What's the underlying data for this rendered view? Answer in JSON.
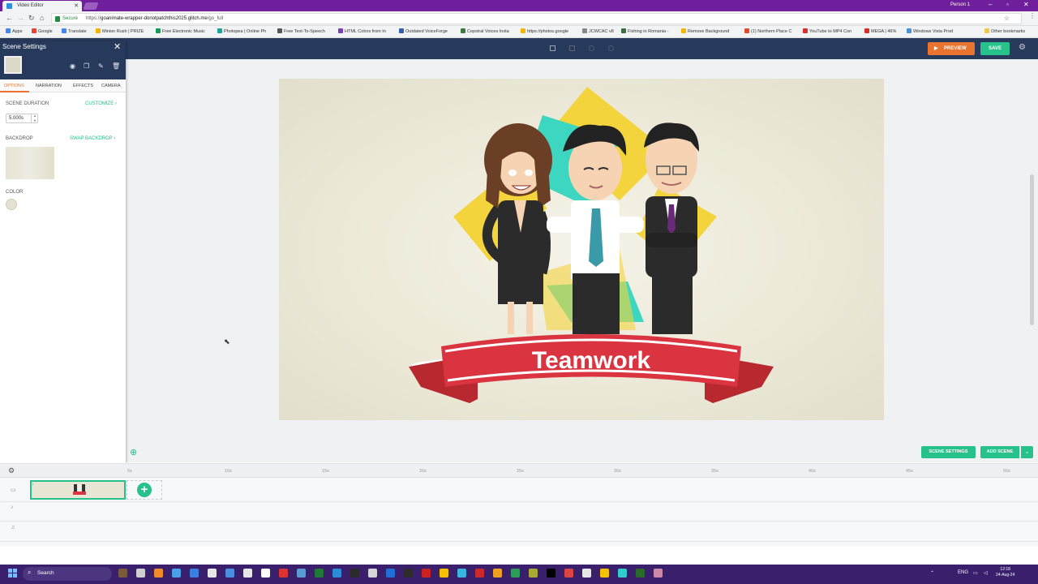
{
  "browser": {
    "tab_title": "Video Editor",
    "profile": "Person 1",
    "secure_label": "Secure",
    "url_prefix": "https://",
    "url_host": "goanimate-wrapper-donotpatchthis2025.glitch.me",
    "url_path": "/go_full",
    "bookmarks": [
      {
        "label": "Apps",
        "color": "#4285f4"
      },
      {
        "label": "Google",
        "color": "#ea4335"
      },
      {
        "label": "Translate",
        "color": "#4285f4"
      },
      {
        "label": "Minion Rush | PRIZE",
        "color": "#f4b400"
      },
      {
        "label": "Free Electronic Music",
        "color": "#0f9d58"
      },
      {
        "label": "Photopea | Online Ph",
        "color": "#18a497"
      },
      {
        "label": "Free Text-To-Speech",
        "color": "#555555"
      },
      {
        "label": "HTML Colors from In",
        "color": "#7b3fb5"
      },
      {
        "label": "Outdated VoiceForge",
        "color": "#2f5fb3"
      },
      {
        "label": "Cepstral Voices Insta",
        "color": "#3a7a3a"
      },
      {
        "label": "https://photos.google",
        "color": "#f4b400"
      },
      {
        "label": "JCWCAC v8",
        "color": "#888888"
      },
      {
        "label": "Fishing in Romania -",
        "color": "#3a6f3a"
      },
      {
        "label": "Remove Background",
        "color": "#f4b400"
      },
      {
        "label": "(1) Northern Place C",
        "color": "#e24a2a"
      },
      {
        "label": "YouTube to MP4 Con",
        "color": "#d93025"
      },
      {
        "label": "MEGA | 46%",
        "color": "#d93025"
      },
      {
        "label": "Windows Vista Prod",
        "color": "#4a90d9"
      },
      {
        "label": "Other bookmarks",
        "color": "#f4c542"
      }
    ]
  },
  "header": {
    "preview_label": "PREVIEW",
    "save_label": "SAVE"
  },
  "panel": {
    "title": "Scene Settings",
    "tabs": [
      {
        "label": "OPTIONS"
      },
      {
        "label": "NARRATION"
      },
      {
        "label": "EFFECTS"
      },
      {
        "label": "CAMERA"
      }
    ],
    "duration_label": "SCENE DURATION",
    "customize_label": "CUSTOMIZE ›",
    "duration_value": "5.000s",
    "backdrop_label": "BACKDROP",
    "swap_backdrop_label": "SWAP BACKDROP ›",
    "color_label": "COLOR"
  },
  "stage": {
    "banner_text": "Teamwork"
  },
  "scene_buttons": {
    "scene_settings_label": "SCENE SETTINGS",
    "add_scene_label": "ADD SCENE"
  },
  "timeline": {
    "ticks": [
      "5s",
      "10s",
      "15s",
      "20s",
      "25s",
      "30s",
      "35s",
      "40s",
      "45s",
      "50s"
    ],
    "scene_number": "1"
  },
  "taskbar": {
    "search_label": "Search",
    "lang": "ENG",
    "time": "12:18",
    "date": "24-Aug-24"
  },
  "colors": {
    "accent_green": "#27c18b",
    "accent_orange": "#e9732f",
    "header_navy": "#283a5b",
    "browser_purple": "#6f1f9b",
    "taskbar_purple": "#3a1f6d",
    "banner_red": "#d9343f"
  }
}
